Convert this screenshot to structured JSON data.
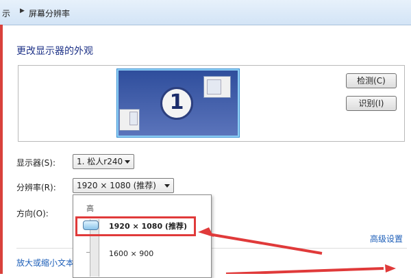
{
  "breadcrumb": {
    "parent_fragment": "示",
    "current": "屏幕分辨率"
  },
  "page_title": "更改显示器的外观",
  "preview": {
    "monitor_number": "1"
  },
  "buttons": {
    "detect": "检测(C)",
    "identify": "识别(I)"
  },
  "fields": {
    "display_label": "显示器(S):",
    "display_value": "1. 松人r240",
    "resolution_label": "分辨率(R):",
    "resolution_value": "1920 × 1080 (推荐)",
    "orientation_label": "方向(O):"
  },
  "resolution_dropdown": {
    "high_label": "高",
    "options": [
      {
        "label": "1920 × 1080 (推荐)",
        "selected": true
      },
      {
        "label": "1600 × 900",
        "selected": false
      }
    ]
  },
  "links": {
    "advanced_settings": "高级设置",
    "zoom_text": "放大或缩小文本"
  },
  "annotation_colors": {
    "highlight": "#e03a3a",
    "arrow": "#e03a3a"
  }
}
